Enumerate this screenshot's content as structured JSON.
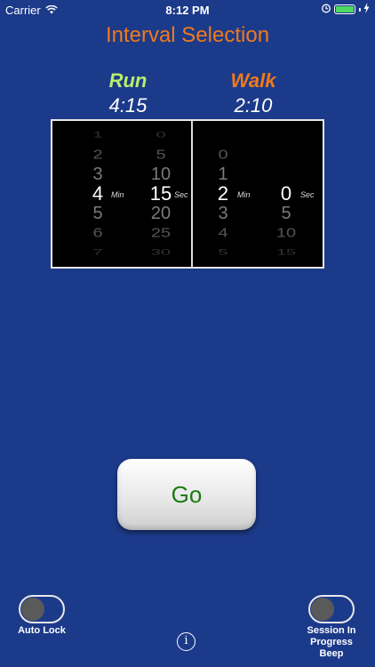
{
  "status": {
    "carrier": "Carrier",
    "time": "8:12 PM",
    "battery_level": 1.0,
    "icons": [
      "wifi-icon",
      "alarm-icon",
      "battery-icon",
      "charging-icon"
    ]
  },
  "title": "Interval Selection",
  "run": {
    "heading": "Run",
    "time": "4:15"
  },
  "walk": {
    "heading": "Walk",
    "time": "2:10"
  },
  "picker": {
    "min_unit": "Min",
    "sec_unit": "Sec",
    "run_min": [
      "1",
      "2",
      "3",
      "4",
      "5",
      "6",
      "7"
    ],
    "run_sec": [
      "0",
      "5",
      "10",
      "15",
      "20",
      "25",
      "30"
    ],
    "walk_min": [
      "0",
      "1",
      "2",
      "3",
      "4",
      "5"
    ],
    "walk_sec": [
      "0",
      "5",
      "10",
      "15"
    ]
  },
  "go_label": "Go",
  "toggles": {
    "auto_lock": {
      "label": "Auto Lock",
      "on": false
    },
    "session_beep": {
      "label_lines": [
        "Session In",
        "Progress",
        "Beep"
      ],
      "on": false
    }
  },
  "info_label": "i",
  "colors": {
    "background": "#1c3a8a",
    "title": "#f07a1a",
    "run": "#b7f06a",
    "walk": "#f07a1a",
    "go_text": "#1d7a12"
  }
}
